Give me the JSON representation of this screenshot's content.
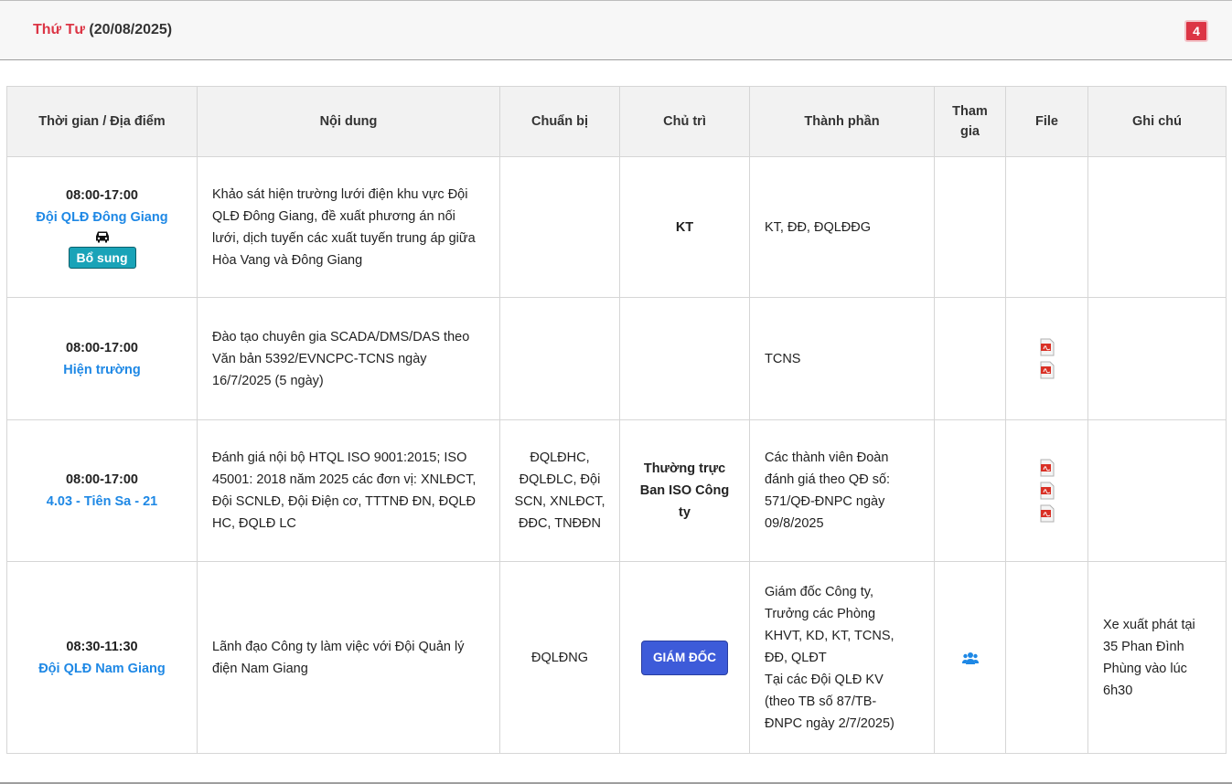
{
  "day_header": {
    "day_name": "Thứ Tư",
    "date": "(20/08/2025)",
    "event_count": "4"
  },
  "table": {
    "headers": [
      "Thời gian / Địa điểm",
      "Nội dung",
      "Chuẩn bị",
      "Chủ trì",
      "Thành phần",
      "Tham gia",
      "File",
      "Ghi chú"
    ],
    "rows": [
      {
        "time": "08:00-17:00",
        "location": "Đội QLĐ Đông Giang",
        "vehicle_icon": "car-icon",
        "badge": "Bổ sung",
        "content": "Khảo sát hiện trường lưới điện khu vực Đội QLĐ Đông Giang, đề xuất phương án nối lưới, dịch tuyến các xuất tuyến trung áp giữa Hòa Vang và Đông Giang",
        "prepare": "",
        "host": "KT",
        "participants": "KT, ĐĐ, ĐQLĐĐG",
        "attend": "",
        "files": 0,
        "note": ""
      },
      {
        "time": "08:00-17:00",
        "location": "Hiện trường",
        "content": "Đào tạo chuyên gia SCADA/DMS/DAS theo Văn bản 5392/EVNCPC-TCNS ngày 16/7/2025 (5 ngày)",
        "prepare": "",
        "host": "",
        "participants": "TCNS",
        "attend": "",
        "files": 2,
        "file_icon": "pdf-file-icon",
        "note": ""
      },
      {
        "time": "08:00-17:00",
        "location": "4.03 - Tiên Sa - 21",
        "content": "Đánh giá nội bộ HTQL ISO 9001:2015; ISO 45001: 2018 năm 2025 các đơn vị: XNLĐCT, Đội SCNLĐ, Đội Điện cơ, TTTNĐ ĐN, ĐQLĐ HC, ĐQLĐ LC",
        "prepare": "ĐQLĐHC, ĐQLĐLC, Đội SCN, XNLĐCT, ĐĐC, TNĐĐN",
        "host": "Thường trực Ban ISO Công ty",
        "participants": "Các thành viên Đoàn đánh giá theo QĐ số: 571/QĐ-ĐNPC ngày 09/8/2025",
        "attend": "",
        "files": 3,
        "file_icon": "pdf-file-icon",
        "note": ""
      },
      {
        "time": "08:30-11:30",
        "location": "Đội QLĐ Nam Giang",
        "content": "Lãnh đạo Công ty làm việc với Đội Quản lý điện Nam Giang",
        "prepare": "ĐQLĐNG",
        "host_button": "GIÁM ĐỐC",
        "participants_lines": [
          "Giám đốc Công ty,",
          "Trưởng các Phòng",
          "KHVT, KD, KT, TCNS,",
          "ĐĐ, QLĐT",
          "Tại các Đội QLĐ KV",
          "(theo TB số 87/TB-",
          "ĐNPC ngày 2/7/2025)"
        ],
        "attend_icon": "users-group-icon",
        "files": 0,
        "note": "Xe xuất phát tại 35 Phan Đình Phùng vào lúc 6h30"
      }
    ]
  },
  "colors": {
    "accent_red": "#dc3545",
    "link_blue": "#1e88e5",
    "teal_badge": "#19a3b8",
    "director_button": "#3d5bd9"
  }
}
